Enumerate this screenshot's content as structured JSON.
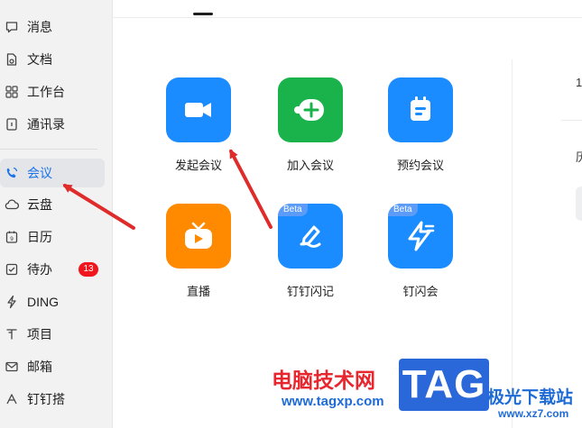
{
  "sidebar": {
    "items": [
      {
        "label": "消息",
        "icon": "message-icon"
      },
      {
        "label": "文档",
        "icon": "document-icon"
      },
      {
        "label": "工作台",
        "icon": "workbench-icon"
      },
      {
        "label": "通讯录",
        "icon": "contacts-icon"
      },
      {
        "label": "会议",
        "icon": "phone-icon"
      },
      {
        "label": "云盘",
        "icon": "cloud-icon"
      },
      {
        "label": "日历",
        "icon": "calendar-icon"
      },
      {
        "label": "待办",
        "icon": "todo-icon",
        "badge": "13"
      },
      {
        "label": "DING",
        "icon": "lightning-icon"
      },
      {
        "label": "项目",
        "icon": "project-icon"
      },
      {
        "label": "邮箱",
        "icon": "mail-icon"
      },
      {
        "label": "钉钉搭",
        "icon": "build-icon"
      }
    ],
    "active_item": "会议"
  },
  "tiles": [
    {
      "label": "发起会议",
      "icon": "video-camera-icon",
      "color": "#1a8cff"
    },
    {
      "label": "加入会议",
      "icon": "join-meeting-icon",
      "color": "#19b24b"
    },
    {
      "label": "预约会议",
      "icon": "schedule-calendar-icon",
      "color": "#1a8cff"
    },
    {
      "label": "直播",
      "icon": "live-tv-icon",
      "color": "#ff8a00"
    },
    {
      "label": "钉钉闪记",
      "icon": "flash-note-icon",
      "color": "#1a8cff",
      "badge": "Beta"
    },
    {
      "label": "钉闪会",
      "icon": "flash-meeting-icon",
      "color": "#1a8cff",
      "badge": "Beta"
    }
  ],
  "right_panel": {
    "text1": "1",
    "text2": "历"
  },
  "watermark": {
    "site_cn": "电脑技术网",
    "site_url": "www.tagxp.com",
    "tag": "TAG",
    "side_cn": "极光下载站",
    "side_url": "www.xz7.com"
  },
  "colors": {
    "accent": "#1a73e8",
    "badge_red": "#f0161e",
    "arrow_red": "#e02b2b"
  }
}
